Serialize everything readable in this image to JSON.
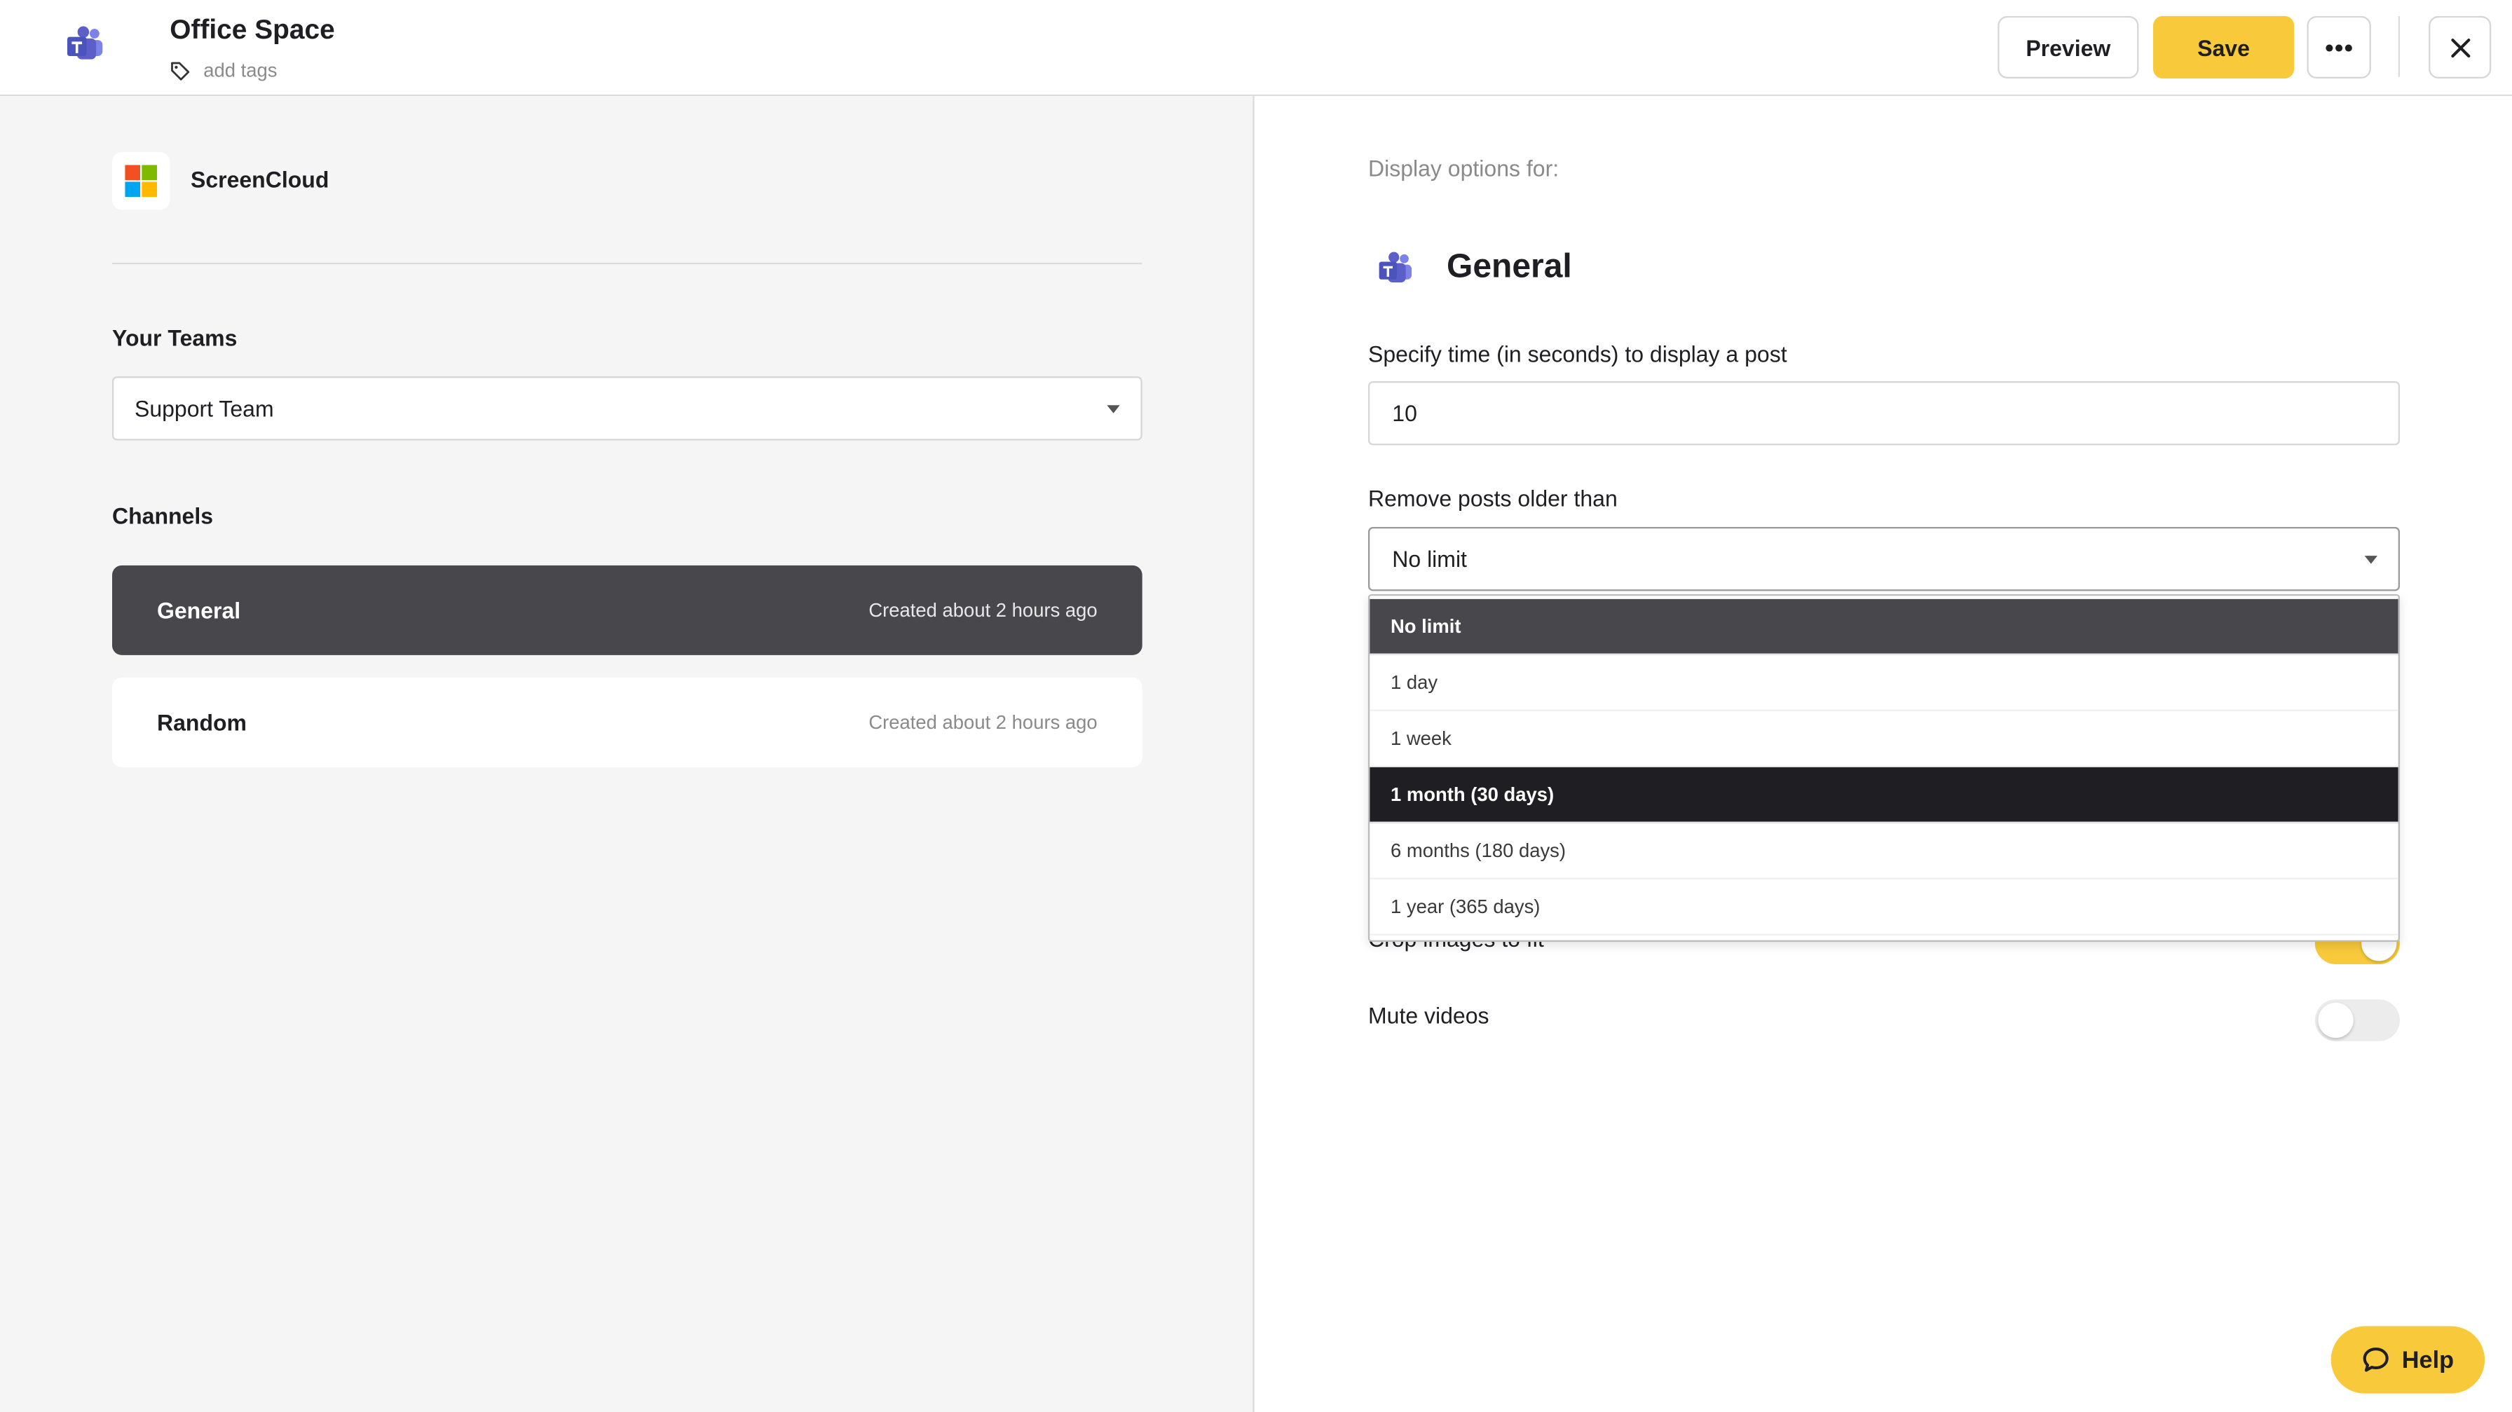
{
  "header": {
    "title": "Office Space",
    "tags_placeholder": "add tags",
    "preview_label": "Preview",
    "save_label": "Save"
  },
  "left": {
    "provider_name": "ScreenCloud",
    "teams_label": "Your Teams",
    "team_selected": "Support Team",
    "channels_label": "Channels",
    "channels": [
      {
        "name": "General",
        "meta": "Created about 2 hours ago",
        "active": true
      },
      {
        "name": "Random",
        "meta": "Created about 2 hours ago",
        "active": false
      }
    ]
  },
  "right": {
    "display_for_label": "Display options for:",
    "channel_title": "General",
    "time_label": "Specify time (in seconds) to display a post",
    "time_value": "10",
    "remove_label": "Remove posts older than",
    "remove_selected": "No limit",
    "remove_options": [
      "No limit",
      "1 day",
      "1 week",
      "1 month (30 days)",
      "6 months (180 days)",
      "1 year (365 days)"
    ],
    "crop_label": "Crop images to fit",
    "crop_on": true,
    "mute_label": "Mute videos",
    "mute_on": false
  },
  "help": {
    "label": "Help"
  },
  "colors": {
    "accent": "#f8c93a",
    "dark": "#47474c",
    "teams_purple": "#5b5fc7"
  }
}
